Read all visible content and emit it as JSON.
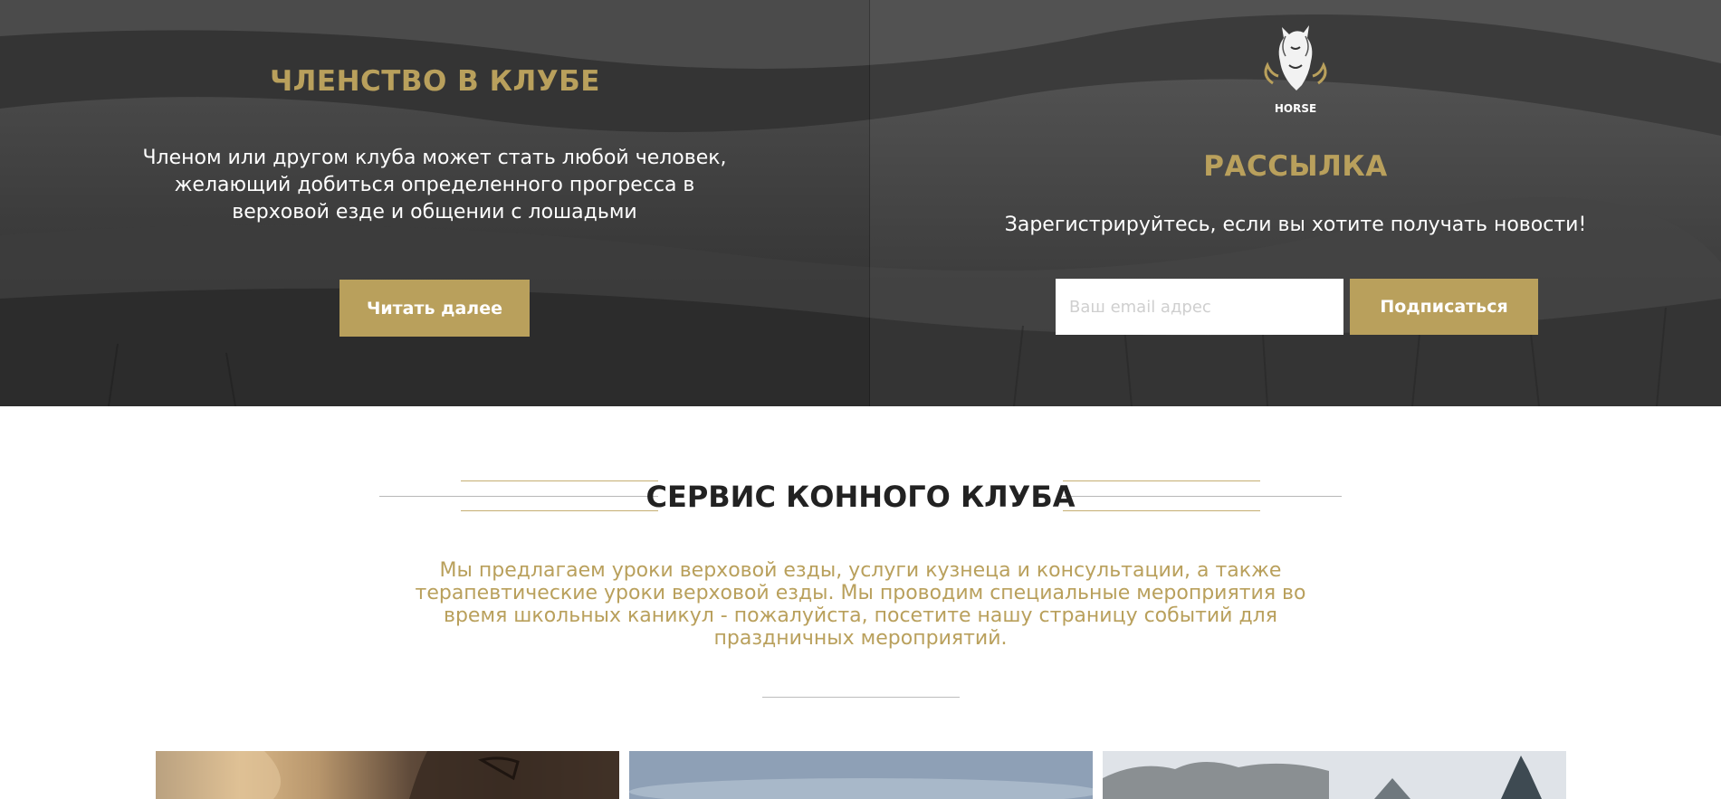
{
  "membership": {
    "title": "ЧЛЕНСТВО В КЛУБЕ",
    "text": "Членом или другом клуба может стать любой человек, желающий добиться определенного прогресса в верховой езде и общении с лошадьми",
    "button_label": "Читать далее"
  },
  "logo": {
    "text": "HORSE",
    "icon": "horse-head-logo"
  },
  "newsletter": {
    "title": "РАССЫЛКА",
    "text": "Зарегистрируйтесь, если вы хотите получать новости!",
    "email_placeholder": "Ваш email адрес",
    "email_value": "",
    "button_label": "Подписаться"
  },
  "services": {
    "title": "СЕРВИС КОННОГО КЛУБА",
    "text": "Мы предлагаем уроки верховой езды, услуги кузнеца и консультации, а также терапевтические уроки верховой езды. Мы проводим специальные мероприятия во время школьных каникул - пожалуйста, посетите нашу страницу событий для праздничных мероприятий."
  },
  "colors": {
    "accent_gold": "#b9a05c",
    "hero_dark": "#333333",
    "text_dark": "#222222"
  }
}
